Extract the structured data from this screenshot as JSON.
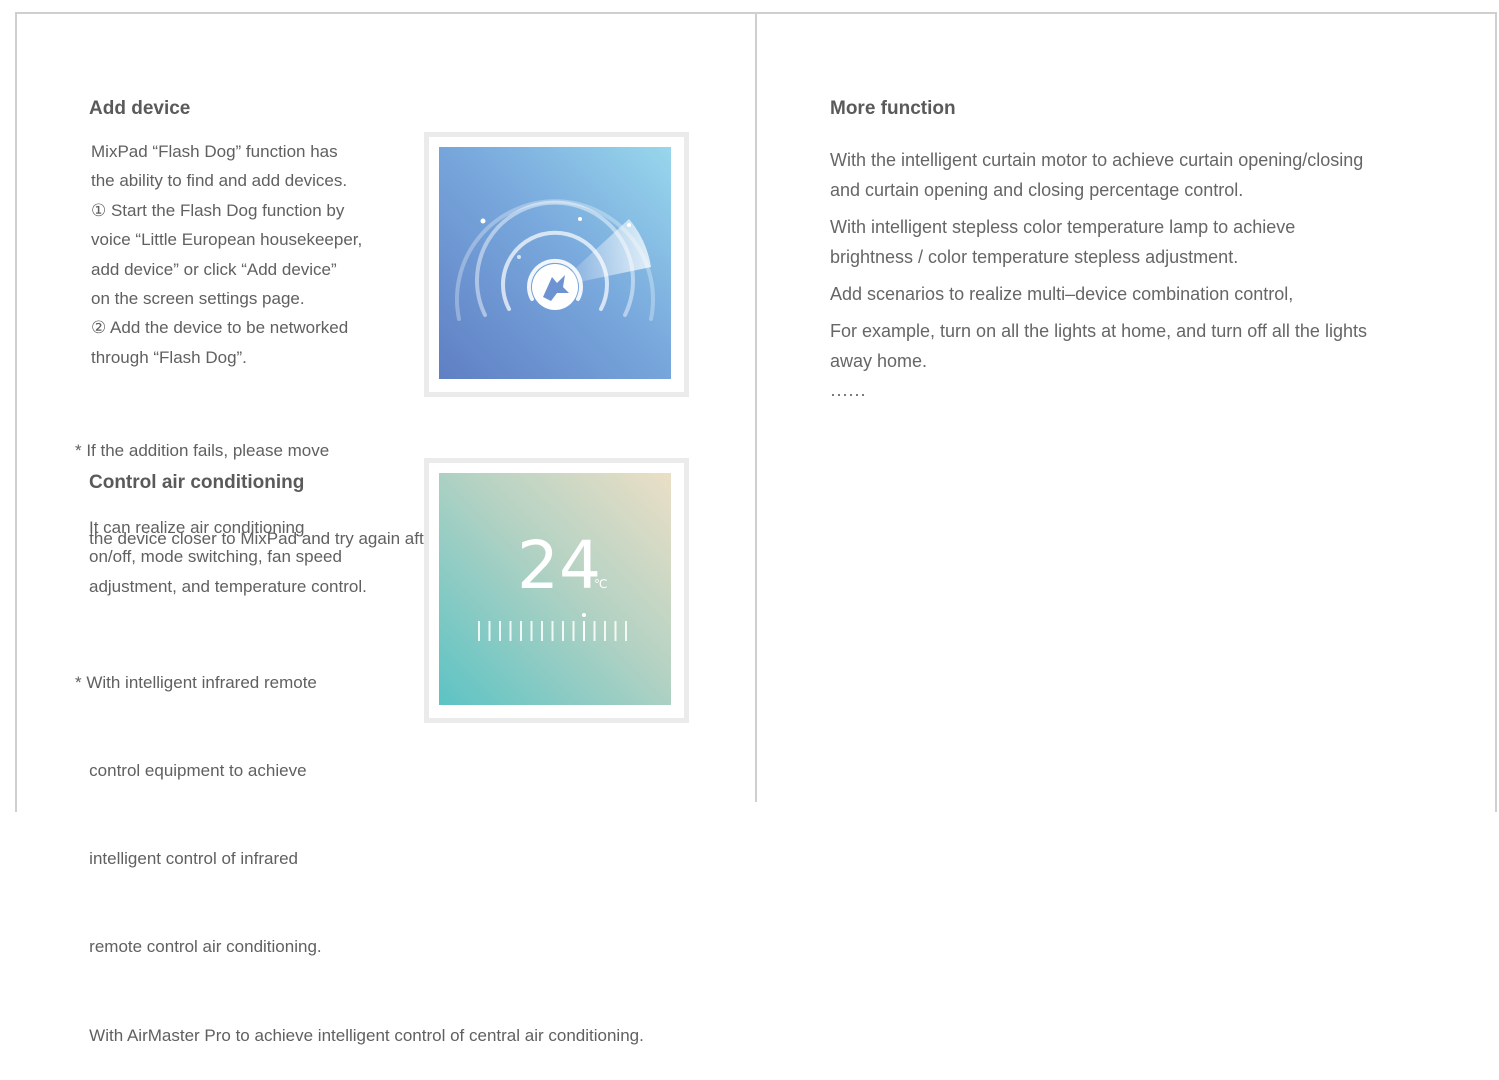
{
  "left": {
    "add_device": {
      "title": "Add device",
      "lines": [
        "MixPad “Flash Dog” function has",
        "the ability to find and add devices.",
        "① Start the Flash Dog function by",
        "voice “Little European housekeeper,",
        "add device” or click “Add device”",
        "on the screen settings page.",
        "② Add the device to be networked",
        "through “Flash Dog”."
      ],
      "note_lines": [
        "* If the addition fails, please move",
        "   the device closer to MixPad and try again after power on."
      ]
    },
    "air_conditioning": {
      "title": "Control air conditioning",
      "lines": [
        "It can realize air conditioning",
        "on/off, mode switching, fan speed",
        "adjustment, and temperature control."
      ],
      "note_lines": [
        "* With intelligent infrared remote",
        "   control equipment to achieve",
        "   intelligent control of infrared",
        "   remote control air conditioning.",
        "   With AirMaster Pro to achieve intelligent control of central air conditioning."
      ],
      "temperature": "24",
      "unit": "℃"
    }
  },
  "right": {
    "title": "More function",
    "paragraphs": [
      [
        "With the intelligent curtain motor to achieve curtain opening/closing",
        "and curtain opening and closing percentage control."
      ],
      [
        "With intelligent stepless color temperature lamp to achieve",
        "brightness / color temperature stepless adjustment."
      ],
      [
        "Add scenarios to realize multi–device combination control,"
      ],
      [
        "For example, turn on all the lights at home, and turn off all the lights",
        "away home."
      ],
      [
        "······"
      ]
    ]
  },
  "colors": {
    "border": "#cfcfcf",
    "text": "#606060",
    "blue_screen": "#79a9dd",
    "teal_screen": "#5cc3c4"
  },
  "icons": {
    "flash_dog": "radar-dog-icon",
    "temperature_scale": "tick-scale-icon"
  }
}
